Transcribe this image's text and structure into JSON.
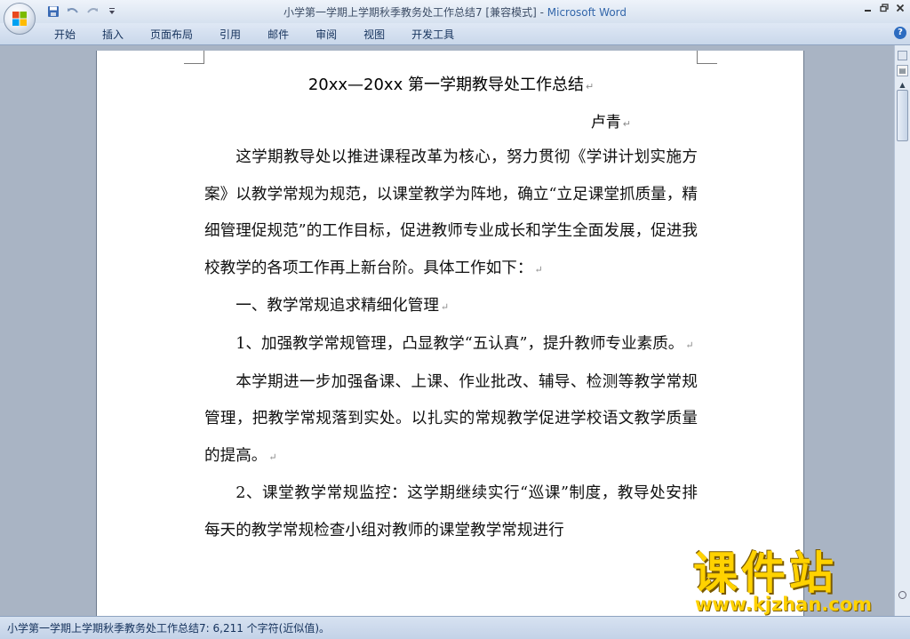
{
  "window": {
    "title": "小学第一学期上学期秋季教务处工作总结7 [兼容模式]",
    "title_separator": " - ",
    "app_name": "Microsoft Word"
  },
  "quick_access": {
    "save_icon": "save-icon",
    "undo_icon": "undo-icon",
    "redo_icon": "redo-icon",
    "customize_icon": "customize-qat-icon"
  },
  "ribbon": {
    "tabs": [
      "开始",
      "插入",
      "页面布局",
      "引用",
      "邮件",
      "审阅",
      "视图",
      "开发工具"
    ],
    "help_label": "?"
  },
  "document": {
    "heading": "20xx—20xx 第一学期教导处工作总结",
    "author": "卢青",
    "paragraphs": [
      "这学期教导处以推进课程改革为核心，努力贯彻《学讲计划实施方案》以教学常规为规范，以课堂教学为阵地，确立“立足课堂抓质量，精细管理促规范”的工作目标，促进教师专业成长和学生全面发展，促进我校教学的各项工作再上新台阶。具体工作如下：",
      "一、教学常规追求精细化管理",
      "1、加强教学常规管理，凸显教学“五认真”，提升教师专业素质。",
      "本学期进一步加强备课、上课、作业批改、辅导、检测等教学常规管理，把教学常规落到实处。以扎实的常规教学促进学校语文教学质量的提高。",
      "2、课堂教学常规监控：这学期继续实行“巡课”制度，教导处安排每天的教学常规检查小组对教师的课堂教学常规进行"
    ],
    "pilcrow": "↵"
  },
  "status": {
    "text": "小学第一学期上学期秋季教务处工作总结7: 6,211 个字符(近似值)。"
  },
  "watermark": {
    "main": "课件站",
    "url": "www.kjzhan.com"
  },
  "colors": {
    "accent": "#3366aa",
    "watermark": "#ffd200"
  }
}
